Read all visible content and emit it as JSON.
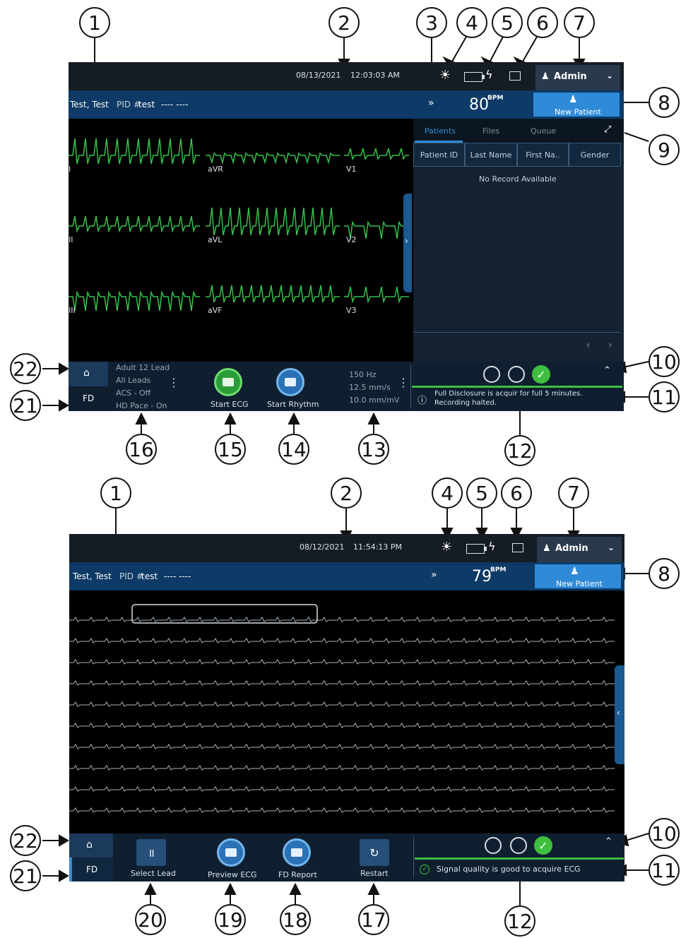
{
  "callouts": [
    "1",
    "2",
    "3",
    "4",
    "5",
    "6",
    "7",
    "8",
    "9",
    "10",
    "11",
    "12",
    "13",
    "14",
    "15",
    "16",
    "17",
    "18",
    "19",
    "20",
    "21",
    "22"
  ],
  "colors": {
    "accent": "#2f8bd8",
    "waveform": "#35c24a",
    "status_green": "#3fbf3f",
    "header_blue": "#0d3a66"
  },
  "screen1": {
    "date": "08/13/2021",
    "time": "12:03:03 AM",
    "user": "Admin",
    "patient_name": "Test, Test",
    "pid_label": "PID #",
    "pid_value": "test",
    "pid_rest": "---- ----",
    "heart_rate": "80",
    "bpm_unit": "BPM",
    "new_patient": "New Patient",
    "leads": [
      "I",
      "aVR",
      "V1",
      "II",
      "aVL",
      "V2",
      "III",
      "aVF",
      "V3"
    ],
    "tabs": [
      "Patients",
      "Files",
      "Queue"
    ],
    "columns": [
      "Patient ID",
      "Last Name",
      "First Na..",
      "Gender"
    ],
    "empty_message": "No Record Available",
    "home_tab": "FD",
    "settings": [
      "Adult 12 Lead",
      "All Leads",
      "ACS - Off",
      "HD Pace - On"
    ],
    "start_ecg": "Start ECG",
    "start_rhythm": "Start Rhythm",
    "filter": [
      "150 Hz",
      "12.5 mm/s",
      "10.0 mm/mV"
    ],
    "status_message_line1": "Full Disclosure is acquir  for full 5 minutes.",
    "status_message_line2": "Recording halted."
  },
  "screen2": {
    "date": "08/12/2021",
    "time": "11:54:13 PM",
    "user": "Admin",
    "patient_name": "Test, Test",
    "pid_label": "PID #",
    "pid_value": "test",
    "pid_rest": "---- ----",
    "heart_rate": "79",
    "bpm_unit": "BPM",
    "new_patient": "New Patient",
    "home_tab": "FD",
    "select_lead": "Select Lead",
    "preview_ecg": "Preview ECG",
    "fd_report": "FD Report",
    "restart": "Restart",
    "status_message": "Signal quality is good to acquire ECG"
  }
}
